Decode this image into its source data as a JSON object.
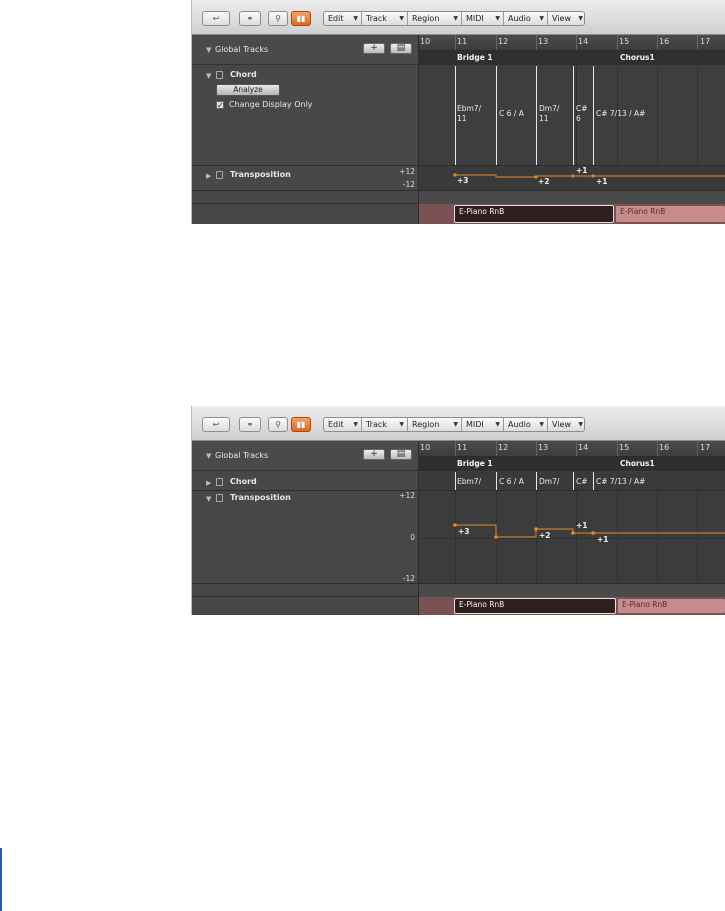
{
  "toolbar": {
    "menus": [
      "Edit",
      "Track",
      "Region",
      "MIDI",
      "Audio",
      "View"
    ]
  },
  "ruler": {
    "shot1_numbers": [
      "10",
      "11",
      "12",
      "13",
      "14",
      "15",
      "16",
      "17"
    ],
    "shot2_numbers": [
      "10",
      "11",
      "12",
      "13",
      "14",
      "15",
      "16",
      "17"
    ]
  },
  "global_tracks_label": "Global Tracks",
  "markers": [
    "Bridge 1",
    "Chorus1"
  ],
  "chord_track": {
    "label": "Chord",
    "analyze_button": "Analyze",
    "change_display_only_label": "Change Display Only",
    "change_display_only_checked": true,
    "chords_expanded": [
      "Ebm7/\n11",
      "C 6 / A",
      "Dm7/\n11",
      "C#\n6",
      "C# 7/13 / A#"
    ],
    "chords_collapsed": [
      "Ebm7/",
      "C 6 / A",
      "Dm7/",
      "C#",
      "C# 7/13 / A#"
    ]
  },
  "transposition_track": {
    "label": "Transposition",
    "scale_top": "+12",
    "scale_middle": "0",
    "scale_bottom": "-12",
    "points": [
      "+3",
      "+2",
      "+1",
      "+1"
    ]
  },
  "regions": [
    "E-Piano RnB",
    "E-Piano RnB"
  ]
}
